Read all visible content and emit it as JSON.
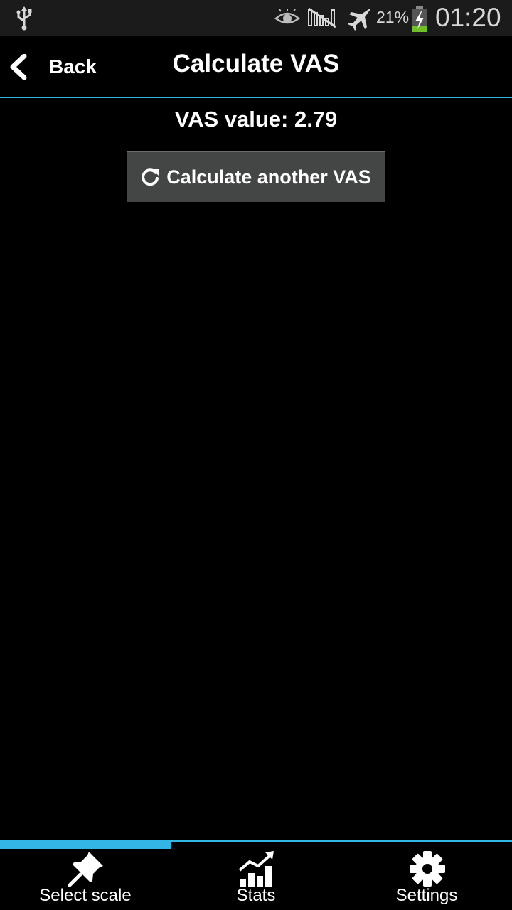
{
  "status_bar": {
    "battery_percent": "21%",
    "time": "01:20",
    "icons": [
      "usb-icon",
      "eye-icon",
      "no-signal-icon",
      "airplane-icon",
      "battery-charging-icon"
    ]
  },
  "action_bar": {
    "back_label": "Back",
    "title": "Calculate VAS",
    "accent_color": "#33b5e5"
  },
  "content": {
    "vas_value_text": "VAS value: 2.79",
    "calc_button_label": "Calculate another VAS"
  },
  "tabs": [
    {
      "label": "Select scale",
      "icon": "pushpin-icon",
      "selected": true
    },
    {
      "label": "Stats",
      "icon": "bar-chart-icon",
      "selected": false
    },
    {
      "label": "Settings",
      "icon": "gear-icon",
      "selected": false
    }
  ]
}
